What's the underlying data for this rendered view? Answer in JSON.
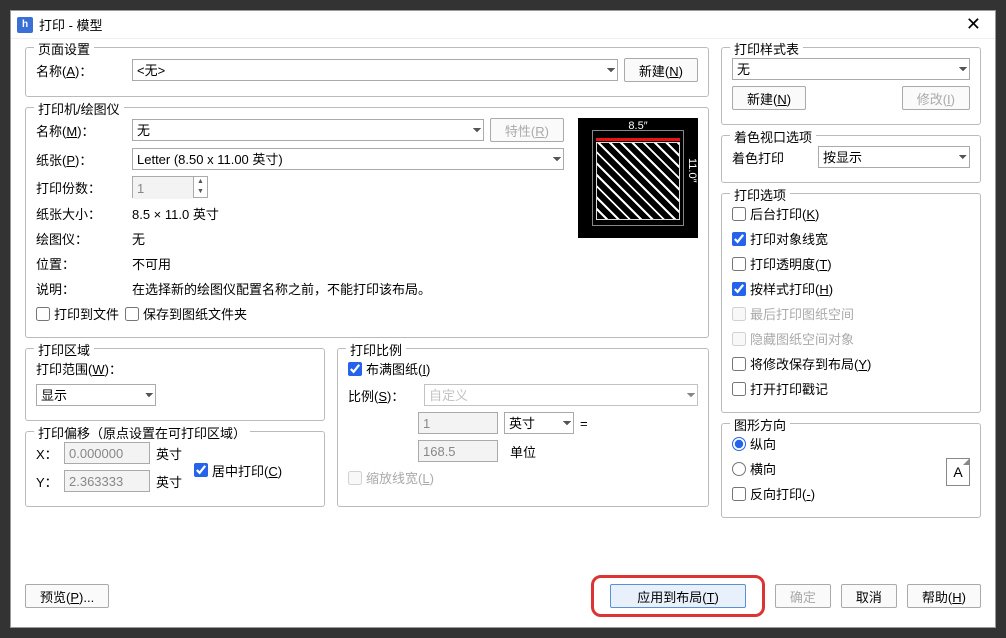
{
  "window": {
    "title": "打印 - 模型"
  },
  "page_setup": {
    "legend": "页面设置",
    "name_label": "名称(A)：",
    "name_value": "<无>",
    "new_btn": "新建(N)"
  },
  "printer": {
    "legend": "打印机/绘图仪",
    "name_label": "名称(M)：",
    "name_value": "无",
    "props_btn": "特性(R)",
    "paper_label": "纸张(P)：",
    "paper_value": "Letter (8.50 x 11.00 英寸)",
    "copies_label": "打印份数：",
    "copies_value": "1",
    "papersize_label": "纸张大小：",
    "papersize_value": "8.5 × 11.0  英寸",
    "plotter_label": "绘图仪：",
    "plotter_value": "无",
    "where_label": "位置：",
    "where_value": "不可用",
    "desc_label": "说明：",
    "desc_value": "在选择新的绘图仪配置名称之前，不能打印该布局。",
    "to_file": "打印到文件",
    "save_to_dwf": "保存到图纸文件夹",
    "preview_w": "8.5″",
    "preview_h": "11.0″"
  },
  "area": {
    "legend": "打印区域",
    "what_label": "打印范围(W)：",
    "what_value": "显示"
  },
  "offset": {
    "legend": "打印偏移（原点设置在可打印区域）",
    "x_label": "X：",
    "x_value": "0.000000",
    "y_label": "Y：",
    "y_value": "2.363333",
    "unit": "英寸",
    "center": "居中打印(C)"
  },
  "scale": {
    "legend": "打印比例",
    "fit": "布满图纸(I)",
    "scale_label": "比例(S)：",
    "scale_value": "自定义",
    "num": "1",
    "num_unit": "英寸",
    "eq": "=",
    "den": "168.5",
    "den_unit": "单位",
    "scale_lw": "缩放线宽(L)"
  },
  "style": {
    "legend": "打印样式表",
    "value": "无",
    "new_btn": "新建(N)",
    "edit_btn": "修改(I)"
  },
  "shade": {
    "legend": "着色视口选项",
    "label": "着色打印",
    "value": "按显示"
  },
  "options": {
    "legend": "打印选项",
    "background": "后台打印(K)",
    "lineweights": "打印对象线宽",
    "transparency": "打印透明度(T)",
    "withstyles": "按样式打印(H)",
    "paperspace_last": "最后打印图纸空间",
    "hide_ps": "隐藏图纸空间对象",
    "save_layout": "将修改保存到布局(Y)",
    "stamp": "打开打印戳记"
  },
  "orient": {
    "legend": "图形方向",
    "portrait": "纵向",
    "landscape": "横向",
    "upside": "反向打印(-)"
  },
  "footer": {
    "preview": "预览(P)...",
    "apply": "应用到布局(T)",
    "ok": "确定",
    "cancel": "取消",
    "help": "帮助(H)"
  }
}
